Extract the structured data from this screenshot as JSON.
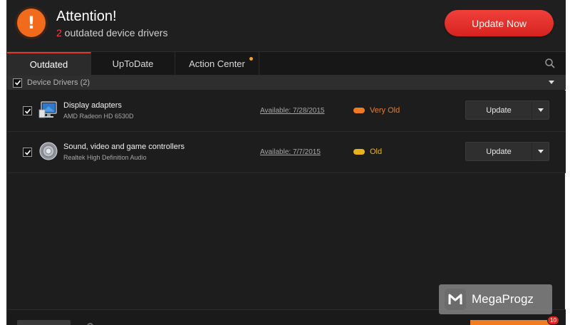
{
  "header": {
    "title": "Attention!",
    "outdated_count": "2",
    "subtitle_text": " outdated device drivers",
    "update_now_label": "Update Now"
  },
  "tabs": [
    {
      "label": "Outdated",
      "active": true
    },
    {
      "label": "UpToDate",
      "active": false
    },
    {
      "label": "Action Center",
      "active": false,
      "notification_dot": true
    }
  ],
  "group": {
    "label": "Device Drivers (2)",
    "checked": true
  },
  "devices": [
    {
      "name": "Display adapters",
      "subtitle": "AMD Radeon HD 6530D",
      "available": "Available: 7/28/2015",
      "status": "Very Old",
      "status_color": "#f07a22",
      "icon": "monitor-icon",
      "checked": true,
      "button_label": "Update"
    },
    {
      "name": "Sound, video and game controllers",
      "subtitle": "Realtek High Definition Audio",
      "available": "Available: 7/7/2015",
      "status": "Old",
      "status_color": "#e9b11a",
      "icon": "speaker-icon",
      "checked": true,
      "button_label": "Update"
    }
  ],
  "footer": {
    "badge_count": "10"
  },
  "watermark": {
    "text": "MegaProgz"
  },
  "colors": {
    "accent_red": "#e03a2e",
    "alert_orange": "#f26a1b",
    "background": "#1d1d1d"
  }
}
